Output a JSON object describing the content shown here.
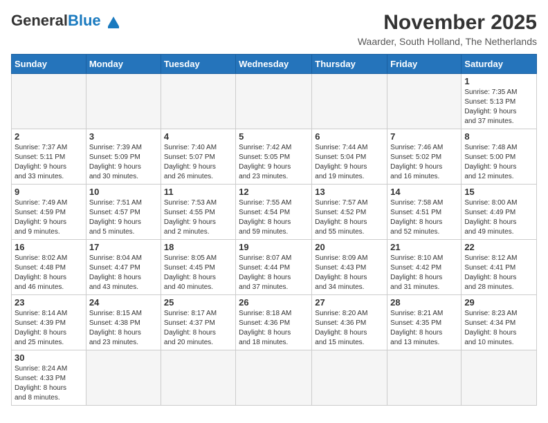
{
  "header": {
    "logo_general": "General",
    "logo_blue": "Blue",
    "month_title": "November 2025",
    "subtitle": "Waarder, South Holland, The Netherlands"
  },
  "weekdays": [
    "Sunday",
    "Monday",
    "Tuesday",
    "Wednesday",
    "Thursday",
    "Friday",
    "Saturday"
  ],
  "weeks": [
    [
      {
        "day": "",
        "info": ""
      },
      {
        "day": "",
        "info": ""
      },
      {
        "day": "",
        "info": ""
      },
      {
        "day": "",
        "info": ""
      },
      {
        "day": "",
        "info": ""
      },
      {
        "day": "",
        "info": ""
      },
      {
        "day": "1",
        "info": "Sunrise: 7:35 AM\nSunset: 5:13 PM\nDaylight: 9 hours\nand 37 minutes."
      }
    ],
    [
      {
        "day": "2",
        "info": "Sunrise: 7:37 AM\nSunset: 5:11 PM\nDaylight: 9 hours\nand 33 minutes."
      },
      {
        "day": "3",
        "info": "Sunrise: 7:39 AM\nSunset: 5:09 PM\nDaylight: 9 hours\nand 30 minutes."
      },
      {
        "day": "4",
        "info": "Sunrise: 7:40 AM\nSunset: 5:07 PM\nDaylight: 9 hours\nand 26 minutes."
      },
      {
        "day": "5",
        "info": "Sunrise: 7:42 AM\nSunset: 5:05 PM\nDaylight: 9 hours\nand 23 minutes."
      },
      {
        "day": "6",
        "info": "Sunrise: 7:44 AM\nSunset: 5:04 PM\nDaylight: 9 hours\nand 19 minutes."
      },
      {
        "day": "7",
        "info": "Sunrise: 7:46 AM\nSunset: 5:02 PM\nDaylight: 9 hours\nand 16 minutes."
      },
      {
        "day": "8",
        "info": "Sunrise: 7:48 AM\nSunset: 5:00 PM\nDaylight: 9 hours\nand 12 minutes."
      }
    ],
    [
      {
        "day": "9",
        "info": "Sunrise: 7:49 AM\nSunset: 4:59 PM\nDaylight: 9 hours\nand 9 minutes."
      },
      {
        "day": "10",
        "info": "Sunrise: 7:51 AM\nSunset: 4:57 PM\nDaylight: 9 hours\nand 5 minutes."
      },
      {
        "day": "11",
        "info": "Sunrise: 7:53 AM\nSunset: 4:55 PM\nDaylight: 9 hours\nand 2 minutes."
      },
      {
        "day": "12",
        "info": "Sunrise: 7:55 AM\nSunset: 4:54 PM\nDaylight: 8 hours\nand 59 minutes."
      },
      {
        "day": "13",
        "info": "Sunrise: 7:57 AM\nSunset: 4:52 PM\nDaylight: 8 hours\nand 55 minutes."
      },
      {
        "day": "14",
        "info": "Sunrise: 7:58 AM\nSunset: 4:51 PM\nDaylight: 8 hours\nand 52 minutes."
      },
      {
        "day": "15",
        "info": "Sunrise: 8:00 AM\nSunset: 4:49 PM\nDaylight: 8 hours\nand 49 minutes."
      }
    ],
    [
      {
        "day": "16",
        "info": "Sunrise: 8:02 AM\nSunset: 4:48 PM\nDaylight: 8 hours\nand 46 minutes."
      },
      {
        "day": "17",
        "info": "Sunrise: 8:04 AM\nSunset: 4:47 PM\nDaylight: 8 hours\nand 43 minutes."
      },
      {
        "day": "18",
        "info": "Sunrise: 8:05 AM\nSunset: 4:45 PM\nDaylight: 8 hours\nand 40 minutes."
      },
      {
        "day": "19",
        "info": "Sunrise: 8:07 AM\nSunset: 4:44 PM\nDaylight: 8 hours\nand 37 minutes."
      },
      {
        "day": "20",
        "info": "Sunrise: 8:09 AM\nSunset: 4:43 PM\nDaylight: 8 hours\nand 34 minutes."
      },
      {
        "day": "21",
        "info": "Sunrise: 8:10 AM\nSunset: 4:42 PM\nDaylight: 8 hours\nand 31 minutes."
      },
      {
        "day": "22",
        "info": "Sunrise: 8:12 AM\nSunset: 4:41 PM\nDaylight: 8 hours\nand 28 minutes."
      }
    ],
    [
      {
        "day": "23",
        "info": "Sunrise: 8:14 AM\nSunset: 4:39 PM\nDaylight: 8 hours\nand 25 minutes."
      },
      {
        "day": "24",
        "info": "Sunrise: 8:15 AM\nSunset: 4:38 PM\nDaylight: 8 hours\nand 23 minutes."
      },
      {
        "day": "25",
        "info": "Sunrise: 8:17 AM\nSunset: 4:37 PM\nDaylight: 8 hours\nand 20 minutes."
      },
      {
        "day": "26",
        "info": "Sunrise: 8:18 AM\nSunset: 4:36 PM\nDaylight: 8 hours\nand 18 minutes."
      },
      {
        "day": "27",
        "info": "Sunrise: 8:20 AM\nSunset: 4:36 PM\nDaylight: 8 hours\nand 15 minutes."
      },
      {
        "day": "28",
        "info": "Sunrise: 8:21 AM\nSunset: 4:35 PM\nDaylight: 8 hours\nand 13 minutes."
      },
      {
        "day": "29",
        "info": "Sunrise: 8:23 AM\nSunset: 4:34 PM\nDaylight: 8 hours\nand 10 minutes."
      }
    ],
    [
      {
        "day": "30",
        "info": "Sunrise: 8:24 AM\nSunset: 4:33 PM\nDaylight: 8 hours\nand 8 minutes."
      },
      {
        "day": "",
        "info": ""
      },
      {
        "day": "",
        "info": ""
      },
      {
        "day": "",
        "info": ""
      },
      {
        "day": "",
        "info": ""
      },
      {
        "day": "",
        "info": ""
      },
      {
        "day": "",
        "info": ""
      }
    ]
  ]
}
